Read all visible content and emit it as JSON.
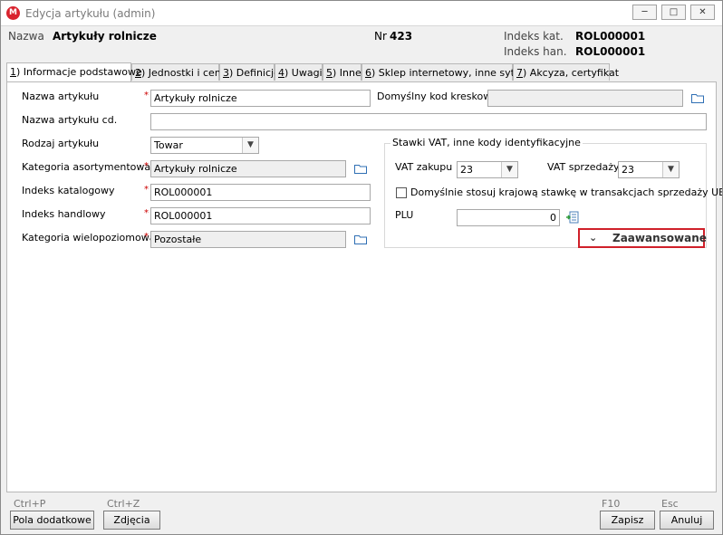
{
  "window": {
    "title": "Edycja artykułu (admin)",
    "app_icon_letter": "M",
    "minimize_icon": "minimize-icon",
    "maximize_icon": "maximize-icon",
    "close_icon": "close-icon"
  },
  "header": {
    "name_label": "Nazwa",
    "name_value": "Artykuły rolnicze",
    "nr_label": "Nr",
    "nr_value": "423",
    "catalog_index_label": "Indeks kat.",
    "catalog_index_value": "ROL000001",
    "trade_index_label": "Indeks han.",
    "trade_index_value": "ROL000001"
  },
  "tabs": [
    {
      "prefix": "1",
      "label": ") Informacje podstawowe"
    },
    {
      "prefix": "2",
      "label": ") Jednostki i ceny"
    },
    {
      "prefix": "3",
      "label": ") Definicje"
    },
    {
      "prefix": "4",
      "label": ") Uwagi"
    },
    {
      "prefix": "5",
      "label": ") Inne"
    },
    {
      "prefix": "6",
      "label": ") Sklep internetowy, inne sytemy"
    },
    {
      "prefix": "7",
      "label": ") Akcyza, certyfikat"
    }
  ],
  "form": {
    "name_label": "Nazwa artykułu",
    "name_value": "Artykuły rolnicze",
    "name_cd_label": "Nazwa artykułu cd.",
    "name_cd_value": "",
    "type_label": "Rodzaj artykułu",
    "type_value": "Towar",
    "category_label": "Kategoria asortymentowa",
    "category_value": "Artykuły rolnicze",
    "catalog_index_label": "Indeks katalogowy",
    "catalog_index_value": "ROL000001",
    "trade_index_label": "Indeks handlowy",
    "trade_index_value": "ROL000001",
    "multilevel_label": "Kategoria wielopoziomowa",
    "multilevel_value": "Pozostałe",
    "barcode_label": "Domyślny kod kreskowy",
    "barcode_value": "",
    "required_mark": "*"
  },
  "vat_group": {
    "title": "Stawki VAT, inne kody identyfikacyjne",
    "purchase_label": "VAT zakupu",
    "purchase_value": "23",
    "sales_label": "VAT sprzedaży",
    "sales_value": "23",
    "domestic_checkbox_label": "Domyślnie stosuj krajową stawkę w transakcjach sprzedaży UE",
    "domestic_checked": false,
    "plu_label": "PLU",
    "plu_value": "0"
  },
  "advanced": {
    "label": "Zaawansowane"
  },
  "footer": {
    "extra_fields_hint": "Ctrl+P",
    "extra_fields_label": "Pola dodatkowe",
    "photos_hint": "Ctrl+Z",
    "photos_label": "Zdjęcia",
    "save_hint": "F10",
    "save_label": "Zapisz",
    "cancel_hint": "Esc",
    "cancel_label": "Anuluj"
  },
  "colors": {
    "accent_red": "#d0202a",
    "required_red": "#cc0000"
  }
}
